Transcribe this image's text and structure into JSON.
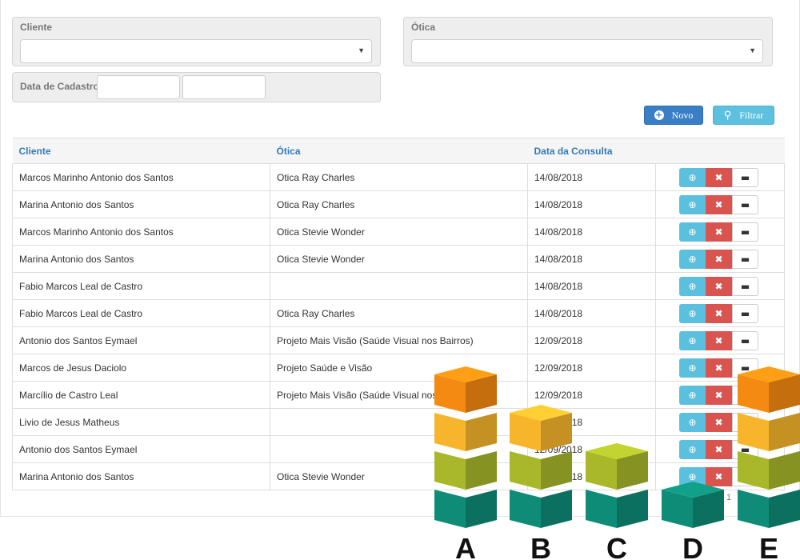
{
  "filters": {
    "cliente_label": "Cliente",
    "otica_label": "Ótica",
    "data_label": "Data de Cadastro",
    "cliente_value": "",
    "otica_value": ""
  },
  "buttons": {
    "novo": "Novo",
    "filtrar": "Filtrar"
  },
  "table": {
    "headers": [
      "Cliente",
      "Ótica",
      "Data da Consulta"
    ],
    "rows": [
      {
        "cliente": "Marcos Marinho Antonio dos Santos",
        "otica": "Otica Ray Charles",
        "data": "14/08/2018"
      },
      {
        "cliente": "Marina Antonio dos Santos",
        "otica": "Otica Ray Charles",
        "data": "14/08/2018"
      },
      {
        "cliente": "Marcos Marinho Antonio dos Santos",
        "otica": "Otica Stevie Wonder",
        "data": "14/08/2018"
      },
      {
        "cliente": "Marina Antonio dos Santos",
        "otica": "Otica Stevie Wonder",
        "data": "14/08/2018"
      },
      {
        "cliente": "Fabio Marcos Leal de Castro",
        "otica": "",
        "data": "14/08/2018"
      },
      {
        "cliente": "Fabio Marcos Leal de Castro",
        "otica": "Otica Ray Charles",
        "data": "14/08/2018"
      },
      {
        "cliente": "Antonio dos Santos Eymael",
        "otica": "Projeto Mais Visão (Saúde Visual nos Bairros)",
        "data": "12/09/2018"
      },
      {
        "cliente": "Marcos de Jesus Daciolo",
        "otica": "Projeto Saúde e Visão",
        "data": "12/09/2018"
      },
      {
        "cliente": "Marcílio de Castro Leal",
        "otica": "Projeto Mais Visão (Saúde Visual nos Bairros)",
        "data": "12/09/2018"
      },
      {
        "cliente": "Livio de Jesus Matheus",
        "otica": "",
        "data": "12/09/2018"
      },
      {
        "cliente": "Antonio dos Santos Eymael",
        "otica": "",
        "data": "12/09/2018"
      },
      {
        "cliente": "Marina Antonio dos Santos",
        "otica": "Otica Stevie Wonder",
        "data": "12/09/2018"
      }
    ]
  },
  "pager": "1",
  "overlay": {
    "labels": [
      "A",
      "B",
      "C",
      "D",
      "E"
    ],
    "stack_heights": [
      4,
      3,
      2,
      1,
      4
    ],
    "colors": [
      "#0f8c78",
      "#a8b82a",
      "#f7b52c",
      "#f58a12",
      "#f05a24"
    ]
  }
}
